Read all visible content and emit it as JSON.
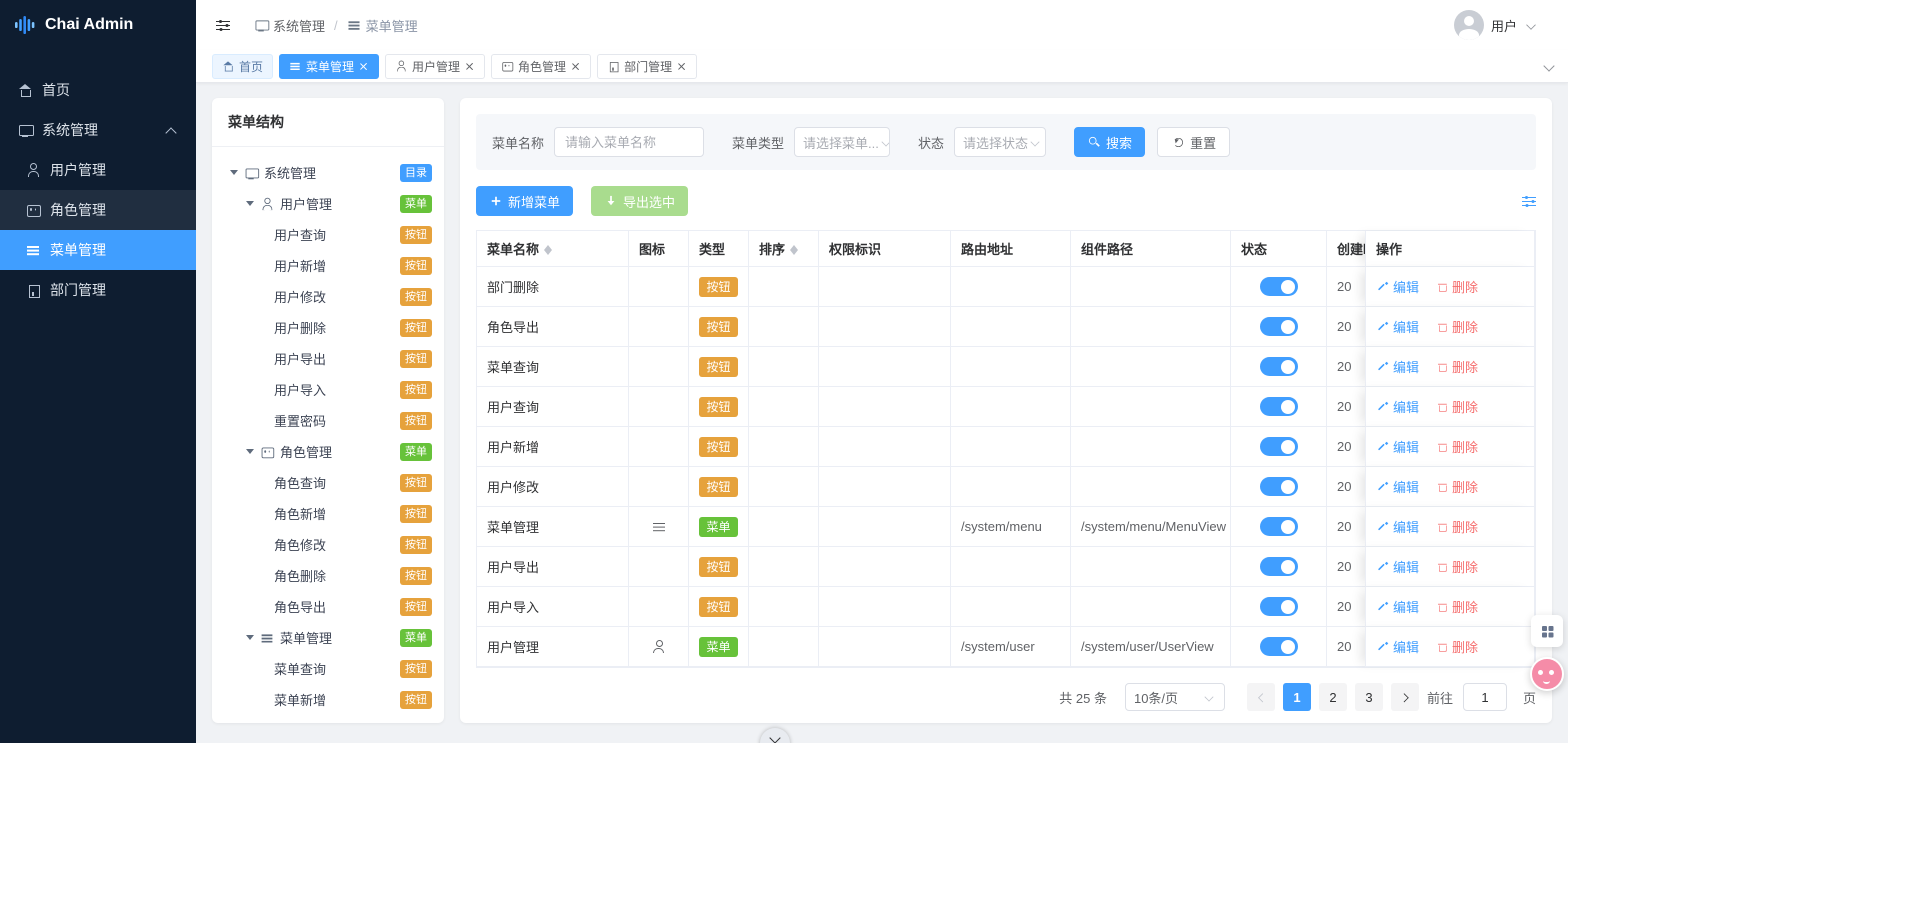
{
  "colors": {
    "primary": "#409eff",
    "success": "#67c23a",
    "warning": "#e6a23c",
    "danger": "#f56c6c",
    "sidebar_bg": "#0e1d30",
    "content_bg": "#f0f2f5"
  },
  "sidebar": {
    "logo": "Chai Admin",
    "home": {
      "label": "首页",
      "icon": "home-icon"
    },
    "group": {
      "label": "系统管理",
      "icon": "monitor-icon"
    },
    "children": [
      {
        "label": "用户管理",
        "icon": "user-icon"
      },
      {
        "label": "角色管理",
        "icon": "role-icon"
      },
      {
        "label": "菜单管理",
        "icon": "menu-icon"
      },
      {
        "label": "部门管理",
        "icon": "dept-icon"
      }
    ]
  },
  "header": {
    "breadcrumb": {
      "first": "系统管理",
      "separator": "/",
      "second": "菜单管理"
    },
    "user": "用户"
  },
  "tabs": [
    {
      "label": "首页",
      "icon": "home",
      "cls": "home",
      "closable": false
    },
    {
      "label": "菜单管理",
      "icon": "menu",
      "cls": "active",
      "closable": true
    },
    {
      "label": "用户管理",
      "icon": "user",
      "cls": "",
      "closable": true
    },
    {
      "label": "角色管理",
      "icon": "role",
      "cls": "",
      "closable": true
    },
    {
      "label": "部门管理",
      "icon": "dept",
      "cls": "",
      "closable": true
    }
  ],
  "tree": {
    "title": "菜单结构",
    "nodes": [
      {
        "label": "系统管理",
        "badge": "目录",
        "badge_cls": "tag-dir",
        "lv": "lv0",
        "caret": true,
        "icon": "monitor"
      },
      {
        "label": "用户管理",
        "badge": "菜单",
        "badge_cls": "tag-menu",
        "lv": "lv1",
        "caret": true,
        "icon": "user"
      },
      {
        "label": "用户查询",
        "badge": "按钮",
        "badge_cls": "tag-btn",
        "lv": "lv2",
        "caret": false,
        "icon": ""
      },
      {
        "label": "用户新增",
        "badge": "按钮",
        "badge_cls": "tag-btn",
        "lv": "lv2",
        "caret": false,
        "icon": ""
      },
      {
        "label": "用户修改",
        "badge": "按钮",
        "badge_cls": "tag-btn",
        "lv": "lv2",
        "caret": false,
        "icon": ""
      },
      {
        "label": "用户删除",
        "badge": "按钮",
        "badge_cls": "tag-btn",
        "lv": "lv2",
        "caret": false,
        "icon": ""
      },
      {
        "label": "用户导出",
        "badge": "按钮",
        "badge_cls": "tag-btn",
        "lv": "lv2",
        "caret": false,
        "icon": ""
      },
      {
        "label": "用户导入",
        "badge": "按钮",
        "badge_cls": "tag-btn",
        "lv": "lv2",
        "caret": false,
        "icon": ""
      },
      {
        "label": "重置密码",
        "badge": "按钮",
        "badge_cls": "tag-btn",
        "lv": "lv2",
        "caret": false,
        "icon": ""
      },
      {
        "label": "角色管理",
        "badge": "菜单",
        "badge_cls": "tag-menu",
        "lv": "lv1",
        "caret": true,
        "icon": "role"
      },
      {
        "label": "角色查询",
        "badge": "按钮",
        "badge_cls": "tag-btn",
        "lv": "lv2",
        "caret": false,
        "icon": ""
      },
      {
        "label": "角色新增",
        "badge": "按钮",
        "badge_cls": "tag-btn",
        "lv": "lv2",
        "caret": false,
        "icon": ""
      },
      {
        "label": "角色修改",
        "badge": "按钮",
        "badge_cls": "tag-btn",
        "lv": "lv2",
        "caret": false,
        "icon": ""
      },
      {
        "label": "角色删除",
        "badge": "按钮",
        "badge_cls": "tag-btn",
        "lv": "lv2",
        "caret": false,
        "icon": ""
      },
      {
        "label": "角色导出",
        "badge": "按钮",
        "badge_cls": "tag-btn",
        "lv": "lv2",
        "caret": false,
        "icon": ""
      },
      {
        "label": "菜单管理",
        "badge": "菜单",
        "badge_cls": "tag-menu",
        "lv": "lv1",
        "caret": true,
        "icon": "menu"
      },
      {
        "label": "菜单查询",
        "badge": "按钮",
        "badge_cls": "tag-btn",
        "lv": "lv2",
        "caret": false,
        "icon": ""
      },
      {
        "label": "菜单新增",
        "badge": "按钮",
        "badge_cls": "tag-btn",
        "lv": "lv2",
        "caret": false,
        "icon": ""
      }
    ]
  },
  "filters": {
    "name_label": "菜单名称",
    "name_placeholder": "请输入菜单名称",
    "type_label": "菜单类型",
    "type_placeholder": "请选择菜单...",
    "status_label": "状态",
    "status_placeholder": "请选择状态",
    "search": "搜索",
    "reset": "重置"
  },
  "toolbar": {
    "add": "新增菜单",
    "export": "导出选中"
  },
  "table": {
    "columns": [
      {
        "label": "菜单名称",
        "sortable": true,
        "w": "c-name"
      },
      {
        "label": "图标",
        "sortable": false,
        "w": "c-icon"
      },
      {
        "label": "类型",
        "sortable": false,
        "w": "c-type"
      },
      {
        "label": "排序",
        "sortable": true,
        "w": "c-sort"
      },
      {
        "label": "权限标识",
        "sortable": false,
        "w": "c-perm"
      },
      {
        "label": "路由地址",
        "sortable": false,
        "w": "c-route"
      },
      {
        "label": "组件路径",
        "sortable": false,
        "w": "c-comp"
      },
      {
        "label": "状态",
        "sortable": false,
        "w": "c-status"
      },
      {
        "label": "创建时间",
        "sortable": false,
        "w": "c-created"
      }
    ],
    "action_label": "操作",
    "edit_label": "编辑",
    "delete_label": "删除",
    "rows": [
      {
        "name": "部门删除",
        "icon": "",
        "type": "按钮",
        "type_cls": "tag-btn",
        "sort": "",
        "perm": "",
        "route": "",
        "component": "",
        "created": "20"
      },
      {
        "name": "角色导出",
        "icon": "",
        "type": "按钮",
        "type_cls": "tag-btn",
        "sort": "",
        "perm": "",
        "route": "",
        "component": "",
        "created": "20"
      },
      {
        "name": "菜单查询",
        "icon": "",
        "type": "按钮",
        "type_cls": "tag-btn",
        "sort": "",
        "perm": "",
        "route": "",
        "component": "",
        "created": "20"
      },
      {
        "name": "用户查询",
        "icon": "",
        "type": "按钮",
        "type_cls": "tag-btn",
        "sort": "",
        "perm": "",
        "route": "",
        "component": "",
        "created": "20"
      },
      {
        "name": "用户新增",
        "icon": "",
        "type": "按钮",
        "type_cls": "tag-btn",
        "sort": "",
        "perm": "",
        "route": "",
        "component": "",
        "created": "20"
      },
      {
        "name": "用户修改",
        "icon": "",
        "type": "按钮",
        "type_cls": "tag-btn",
        "sort": "",
        "perm": "",
        "route": "",
        "component": "",
        "created": "20"
      },
      {
        "name": "菜单管理",
        "icon": "menu",
        "type": "菜单",
        "type_cls": "tag-menu",
        "sort": "",
        "perm": "",
        "route": "/system/menu",
        "component": "/system/menu/MenuView",
        "created": "20"
      },
      {
        "name": "用户导出",
        "icon": "",
        "type": "按钮",
        "type_cls": "tag-btn",
        "sort": "",
        "perm": "",
        "route": "",
        "component": "",
        "created": "20"
      },
      {
        "name": "用户导入",
        "icon": "",
        "type": "按钮",
        "type_cls": "tag-btn",
        "sort": "",
        "perm": "",
        "route": "",
        "component": "",
        "created": "20"
      },
      {
        "name": "用户管理",
        "icon": "user",
        "type": "菜单",
        "type_cls": "tag-menu",
        "sort": "",
        "perm": "",
        "route": "/system/user",
        "component": "/system/user/UserView",
        "created": "20"
      }
    ]
  },
  "pagination": {
    "total": "共 25 条",
    "page_size": "10条/页",
    "pages": [
      {
        "n": "1",
        "cls": "active"
      },
      {
        "n": "2",
        "cls": ""
      },
      {
        "n": "3",
        "cls": ""
      }
    ],
    "goto_label": "前往",
    "goto_value": "1",
    "unit": "页"
  }
}
